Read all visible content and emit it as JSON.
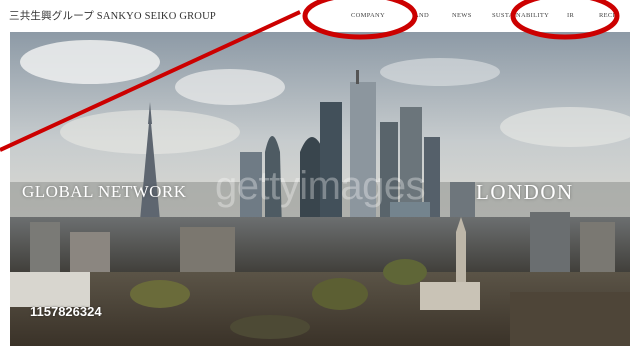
{
  "header": {
    "brand": "三共生興グループ SANKYO SEIKO GROUP",
    "nav": [
      {
        "label": "COMPANY"
      },
      {
        "label": "AND"
      },
      {
        "label": "NEWS"
      },
      {
        "label": "SUSTAINABILITY"
      },
      {
        "label": "IR"
      },
      {
        "label": "RECR"
      }
    ]
  },
  "hero": {
    "left_caption": "GLOBAL NETWORK",
    "right_caption": "LONDON",
    "watermark": "gettyimages",
    "image_id": "1157826324"
  },
  "colors": {
    "annotation_red": "#cc0000",
    "header_bg": "#ffffff",
    "caption_text": "#ffffff"
  }
}
